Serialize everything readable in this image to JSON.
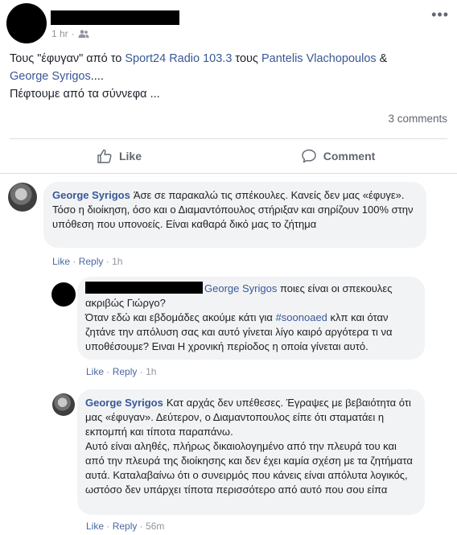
{
  "post": {
    "time": "1 hr",
    "line1_a": "Τους \"έφυγαν\" από το ",
    "line1_link1": "Sport24 Radio 103.3",
    "line1_b": " τους ",
    "line1_link2": "Pantelis Vlachopoulos",
    "line1_c": " &",
    "line2_link": "George Syrigos",
    "line2_rest": "....",
    "line3": "Πέφτουμε από τα σύννεφα ...",
    "comments_count": "3 comments",
    "like_label": "Like",
    "comment_label": "Comment",
    "more_icon": "•••"
  },
  "comments": [
    {
      "author": "George Syrigos",
      "text": "Άσε σε παρακαλώ τις σπέκουλες. Κανείς δεν μας «έφυγε». Τόσο η διοίκηση, όσο και ο Διαμαντόπουλος στήριξαν και σηρίζουν 100% στην υπόθεση που υπονοείς. Είναι καθαρά δικό μας το ζήτημα",
      "like": "Like",
      "reply": "Reply",
      "time": "1h"
    },
    {
      "mention": "George Syrigos",
      "text1": " ποιες είναι οι σπεκουλες ακριβώς Γιώργο?",
      "text2_a": "Όταν εδώ και εβδομάδες ακούμε κάτι για ",
      "hashtag": "#soonoaed",
      "text2_b": " κλπ και όταν ζητάνε την απόλυση σας και αυτό γίνεται λίγο καιρό αργότερα τι να υποθέσουμε? Ειναι Η χρονική περίοδος η οποία γίνεται αυτό.",
      "like": "Like",
      "reply": "Reply",
      "time": "1h"
    },
    {
      "author": "George Syrigos",
      "text1": "Κατ αρχάς δεν υπέθεσες. Έγραψες με βεβαιότητα ότι μας «έφυγαν». Δεύτερον, ο Διαμαντοπουλος είπε ότι σταματάει η εκπομπή και τίποτα παραπάνω.",
      "text2": "Αυτό είναι αληθές, πλήρως δικαιολογημένο από την πλευρά του και από την πλευρά της διοίκησης και δεν έχει καμία σχέση με τα ζητήματα αυτά. Καταλαβαίνω ότι ο συνειρμός που κάνεις είναι απόλυτα λογικός, ωστόσο δεν υπάρχει τίποτα περισσότερο από αυτό που σου είπα",
      "like": "Like",
      "reply": "Reply",
      "time": "56m"
    }
  ],
  "separator": "·"
}
